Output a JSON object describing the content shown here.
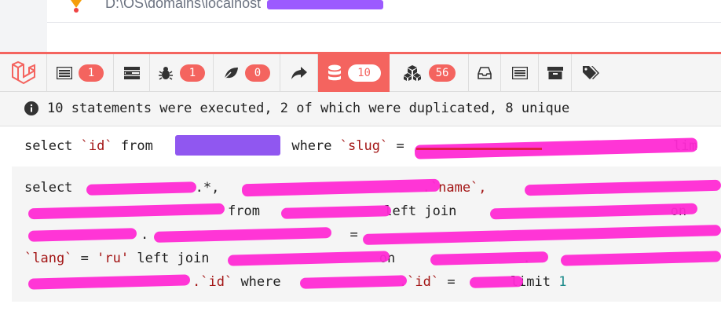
{
  "window": {
    "path_prefix": "D:\\OS\\domains\\localhost"
  },
  "debugbar": {
    "tabs": [
      {
        "name": "messages",
        "icon": "list-icon",
        "badge": "1"
      },
      {
        "name": "timeline",
        "icon": "timeline-icon",
        "badge": ""
      },
      {
        "name": "exceptions",
        "icon": "bug-icon",
        "badge": "1"
      },
      {
        "name": "views",
        "icon": "leaf-icon",
        "badge": "0"
      },
      {
        "name": "route",
        "icon": "share-icon",
        "badge": ""
      },
      {
        "name": "queries",
        "icon": "database-icon",
        "badge": "10",
        "active": true
      },
      {
        "name": "models",
        "icon": "cubes-icon",
        "badge": "56"
      },
      {
        "name": "mails",
        "icon": "inbox-icon",
        "badge": ""
      },
      {
        "name": "request",
        "icon": "list-alt-icon",
        "badge": ""
      },
      {
        "name": "session",
        "icon": "archive-icon",
        "badge": ""
      },
      {
        "name": "tags",
        "icon": "tags-icon",
        "badge": ""
      }
    ],
    "colors": {
      "accent": "#f4645f",
      "bar_bg": "#f5f5f5"
    }
  },
  "queries": {
    "summary": "10 statements were executed, 2 of which were duplicated, 8 unique",
    "stmt1": {
      "select": "select",
      "id": "`id`",
      "from": "from",
      "where": "where",
      "slug": "`slug`",
      "eq": "=",
      "limit_partial": "lim"
    },
    "stmt2": {
      "l1_select": "select",
      "l1_star": ".*,",
      "l1_name": ".`name`,",
      "l2_from": "from",
      "l2_leftjoin": "left join",
      "l2_on": "on",
      "l3_eq": "=",
      "l3_dot": ".",
      "l4_lang": "`lang`",
      "l4_eq": "=",
      "l4_ru": "'ru'",
      "l4_leftjoin": "left join",
      "l4_on": "on",
      "l4_dot": ".",
      "l5_id": ".`id`",
      "l5_where": "where",
      "l5_id2": ".`id`",
      "l5_eq": "=",
      "l5_limit": "limit",
      "l5_one": "1"
    }
  }
}
